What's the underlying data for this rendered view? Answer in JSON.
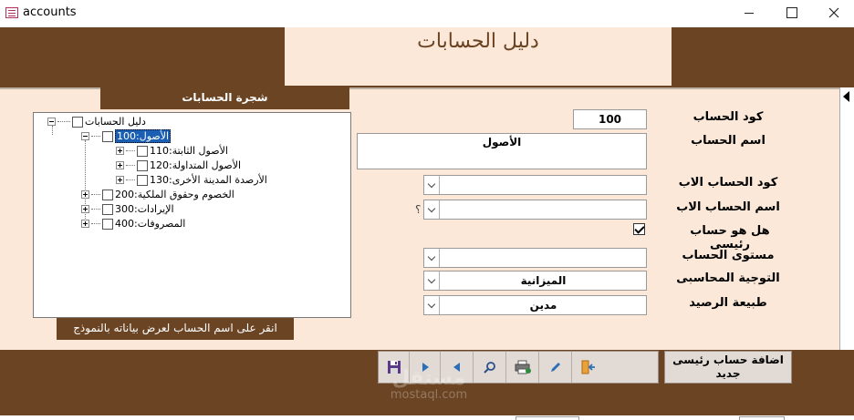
{
  "window": {
    "title": "accounts"
  },
  "header": {
    "title": "دليل الحسابات"
  },
  "tree": {
    "header": "شجرة الحسابات",
    "root": "دليل الحسابات",
    "items": [
      {
        "label": "الأصول:100",
        "selected": true
      },
      {
        "label": "الأصول الثابتة:110"
      },
      {
        "label": "الأصول المتداولة:120"
      },
      {
        "label": "الأرصدة المدينة الأخرى:130"
      },
      {
        "label": "الخصوم وحقوق الملكية:200"
      },
      {
        "label": "الإيرادات:300"
      },
      {
        "label": "المصروفات:400"
      }
    ],
    "hint": "انقر على اسم الحساب لعرض بياناته بالنموذج"
  },
  "form": {
    "account_code_label": "كود الحساب",
    "account_code_value": "100",
    "account_name_label": "اسم الحساب",
    "account_name_value": "الأصول",
    "parent_code_label": "كود الحساب الاب",
    "parent_code_value": "",
    "parent_name_label": "اسم الحساب الاب",
    "parent_name_value": "",
    "parent_name_suffix": "؟",
    "is_main_label": "هل هو حساب رئيسى",
    "is_main_checked": true,
    "level_label": "مستوى الحساب",
    "level_value": "",
    "direction_label": "التوجية المحاسبى",
    "direction_value": "الميزانية",
    "balance_label": "طبيعة الرصيد",
    "balance_value": "مدين"
  },
  "footer": {
    "add_main_label": "اضافة حساب رئيسى جديد",
    "watermark_ar": "مستقل",
    "watermark_lat": "mostaql.com"
  },
  "colors": {
    "brown": "#6b4423",
    "cream": "#fbe8d9",
    "selection": "#1a5fb4"
  },
  "icons": [
    "save-icon",
    "next-record-icon",
    "previous-record-icon",
    "find-icon",
    "print-icon",
    "edit-icon",
    "exit-icon"
  ]
}
